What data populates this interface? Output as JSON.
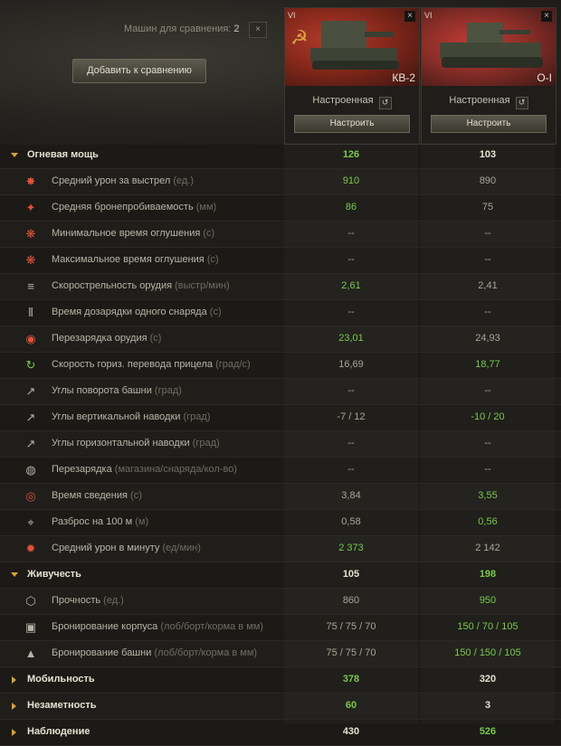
{
  "compare": {
    "label": "Машин для сравнения:",
    "count": "2",
    "clear": "×",
    "add_button": "Добавить к сравнению"
  },
  "vehicles": [
    {
      "tier": "VI",
      "name": "КВ-2",
      "status": "Настроенная",
      "config": "Настроить",
      "close": "×"
    },
    {
      "tier": "VI",
      "name": "O-I",
      "status": "Настроенная",
      "config": "Настроить",
      "close": "×"
    }
  ],
  "rows": [
    {
      "type": "cat",
      "label": "Огневая мощь",
      "a": "126",
      "b": "103",
      "ca": "g",
      "cb": "w",
      "expanded": true
    },
    {
      "type": "param",
      "icon": "✸",
      "ic": "red-i",
      "label": "Средний урон за выстрел",
      "unit": "(ед.)",
      "a": "910",
      "b": "890",
      "ca": "g",
      "cb": "n"
    },
    {
      "type": "param",
      "icon": "✦",
      "ic": "red-i",
      "label": "Средняя бронепробиваемость",
      "unit": "(мм)",
      "a": "86",
      "b": "75",
      "ca": "g",
      "cb": "n"
    },
    {
      "type": "param",
      "icon": "❋",
      "ic": "red-i",
      "label": "Минимальное время оглушения",
      "unit": "(с)",
      "a": "--",
      "b": "--",
      "ca": "n",
      "cb": "n"
    },
    {
      "type": "param",
      "icon": "❋",
      "ic": "red-i",
      "label": "Максимальное время оглушения",
      "unit": "(с)",
      "a": "--",
      "b": "--",
      "ca": "n",
      "cb": "n"
    },
    {
      "type": "param",
      "icon": "≡",
      "ic": "grey-i",
      "label": "Скорострельность орудия",
      "unit": "(выстр/мин)",
      "a": "2,61",
      "b": "2,41",
      "ca": "g",
      "cb": "n"
    },
    {
      "type": "param",
      "icon": "⦀",
      "ic": "grey-i",
      "label": "Время дозарядки одного снаряда",
      "unit": "(с)",
      "a": "--",
      "b": "--",
      "ca": "n",
      "cb": "n"
    },
    {
      "type": "param",
      "icon": "◉",
      "ic": "red-i",
      "label": "Перезарядка орудия",
      "unit": "(с)",
      "a": "23,01",
      "b": "24,93",
      "ca": "g",
      "cb": "n"
    },
    {
      "type": "param",
      "icon": "↻",
      "ic": "green-i",
      "label": "Скорость гориз. перевода прицела",
      "unit": "(град/с)",
      "a": "16,69",
      "b": "18,77",
      "ca": "n",
      "cb": "g"
    },
    {
      "type": "param",
      "icon": "↗",
      "ic": "grey-i",
      "label": "Углы поворота башни",
      "unit": "(град)",
      "a": "--",
      "b": "--",
      "ca": "n",
      "cb": "n"
    },
    {
      "type": "param",
      "icon": "↗",
      "ic": "grey-i",
      "label": "Углы вертикальной наводки",
      "unit": "(град)",
      "a": "-7 / 12",
      "b": "-10 / 20",
      "ca": "n",
      "cb": "g"
    },
    {
      "type": "param",
      "icon": "↗",
      "ic": "grey-i",
      "label": "Углы горизонтальной наводки",
      "unit": "(град)",
      "a": "--",
      "b": "--",
      "ca": "n",
      "cb": "n"
    },
    {
      "type": "param",
      "icon": "◍",
      "ic": "grey-i",
      "label": "Перезарядка",
      "unit": "(магазина/снаряда/кол-во)",
      "a": "--",
      "b": "--",
      "ca": "n",
      "cb": "n"
    },
    {
      "type": "param",
      "icon": "◎",
      "ic": "red-i",
      "label": "Время сведения",
      "unit": "(с)",
      "a": "3,84",
      "b": "3,55",
      "ca": "n",
      "cb": "g"
    },
    {
      "type": "param",
      "icon": "⌖",
      "ic": "grey-i",
      "label": "Разброс на 100 м",
      "unit": "(м)",
      "a": "0,58",
      "b": "0,56",
      "ca": "n",
      "cb": "g"
    },
    {
      "type": "param",
      "icon": "✹",
      "ic": "red-i",
      "label": "Средний урон в минуту",
      "unit": "(ед/мин)",
      "a": "2 373",
      "b": "2 142",
      "ca": "g",
      "cb": "n"
    },
    {
      "type": "cat",
      "label": "Живучесть",
      "a": "105",
      "b": "198",
      "ca": "w",
      "cb": "g",
      "expanded": true
    },
    {
      "type": "param",
      "icon": "⬡",
      "ic": "grey-i",
      "label": "Прочность",
      "unit": "(ед.)",
      "a": "860",
      "b": "950",
      "ca": "n",
      "cb": "g"
    },
    {
      "type": "param",
      "icon": "▣",
      "ic": "grey-i",
      "label": "Бронирование корпуса",
      "unit": "(лоб/борт/корма в мм)",
      "a": "75 / 75 / 70",
      "b": "150 / 70 / 105",
      "ca": "n",
      "cb": "g"
    },
    {
      "type": "param",
      "icon": "▲",
      "ic": "grey-i",
      "label": "Бронирование башни",
      "unit": "(лоб/борт/корма в мм)",
      "a": "75 / 75 / 70",
      "b": "150 / 150 / 105",
      "ca": "n",
      "cb": "g"
    },
    {
      "type": "cat",
      "label": "Мобильность",
      "a": "378",
      "b": "320",
      "ca": "g",
      "cb": "w",
      "expanded": false
    },
    {
      "type": "cat",
      "label": "Незаметность",
      "a": "60",
      "b": "3",
      "ca": "g",
      "cb": "w",
      "expanded": false
    },
    {
      "type": "cat",
      "label": "Наблюдение",
      "a": "430",
      "b": "526",
      "ca": "w",
      "cb": "g",
      "expanded": false
    }
  ]
}
